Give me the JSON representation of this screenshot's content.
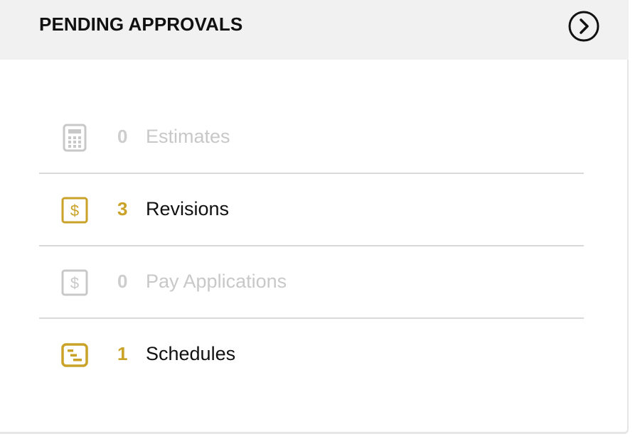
{
  "panel": {
    "title": "PENDING APPROVALS",
    "open_icon": "chevron-right-circle-icon"
  },
  "colors": {
    "accent": "#c9a227",
    "muted": "#c8c8c8",
    "text": "#111111",
    "header_bg": "#f1f1f1",
    "divider": "#d9d9d9"
  },
  "approvals": [
    {
      "count": "0",
      "label": "Estimates",
      "icon": "calculator-icon",
      "state": "muted"
    },
    {
      "count": "3",
      "label": "Revisions",
      "icon": "dollar-document-icon",
      "state": "active"
    },
    {
      "count": "0",
      "label": "Pay Applications",
      "icon": "dollar-document-icon",
      "state": "muted"
    },
    {
      "count": "1",
      "label": "Schedules",
      "icon": "schedule-gantt-icon",
      "state": "active"
    }
  ]
}
